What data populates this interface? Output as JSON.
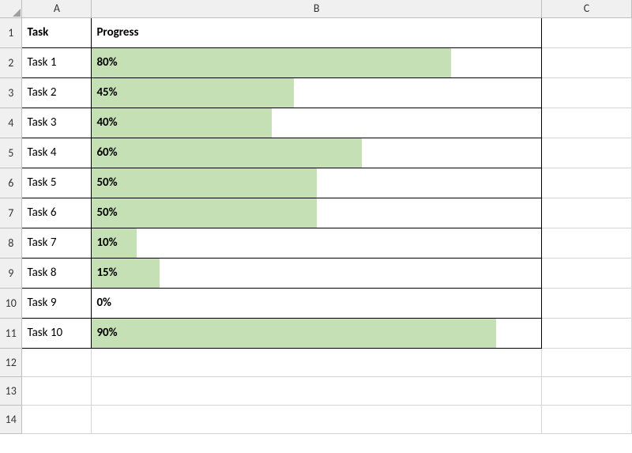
{
  "columns": [
    "A",
    "B",
    "C"
  ],
  "row_numbers": [
    1,
    2,
    3,
    4,
    5,
    6,
    7,
    8,
    9,
    10,
    11,
    12,
    13,
    14
  ],
  "headers": {
    "task": "Task",
    "progress": "Progress"
  },
  "rows": [
    {
      "task": "Task 1",
      "progress": 80,
      "label": "80%"
    },
    {
      "task": "Task 2",
      "progress": 45,
      "label": "45%"
    },
    {
      "task": "Task 3",
      "progress": 40,
      "label": "40%"
    },
    {
      "task": "Task 4",
      "progress": 60,
      "label": "60%"
    },
    {
      "task": "Task 5",
      "progress": 50,
      "label": "50%"
    },
    {
      "task": "Task 6",
      "progress": 50,
      "label": "50%"
    },
    {
      "task": "Task 7",
      "progress": 10,
      "label": "10%"
    },
    {
      "task": "Task 8",
      "progress": 15,
      "label": "15%"
    },
    {
      "task": "Task 9",
      "progress": 0,
      "label": "0%"
    },
    {
      "task": "Task 10",
      "progress": 90,
      "label": "90%"
    }
  ],
  "colors": {
    "bar": "#c5e0b4"
  },
  "chart_data": {
    "type": "bar",
    "title": "",
    "xlabel": "Progress",
    "ylabel": "Task",
    "categories": [
      "Task 1",
      "Task 2",
      "Task 3",
      "Task 4",
      "Task 5",
      "Task 6",
      "Task 7",
      "Task 8",
      "Task 9",
      "Task 10"
    ],
    "values": [
      80,
      45,
      40,
      60,
      50,
      50,
      10,
      15,
      0,
      90
    ],
    "xlim": [
      0,
      100
    ],
    "grid": false,
    "legend": false,
    "note": "In-cell data bars (Excel conditional formatting)"
  }
}
